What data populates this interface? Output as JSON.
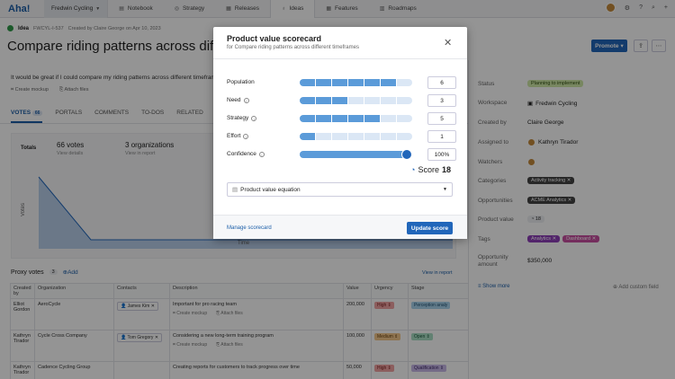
{
  "nav": {
    "logo": "Aha!",
    "workspace": "Fredwin Cycling",
    "tabs": [
      "Notebook",
      "Strategy",
      "Releases",
      "Ideas",
      "Features",
      "Roadmaps"
    ]
  },
  "idea": {
    "type": "Idea",
    "ref": "FWCYL-I-537",
    "created": "Created by Claire George on Apr 10, 2023",
    "title": "Compare riding patterns across different timeframes",
    "promote": "Promote",
    "description": "It would be great if I could compare my riding patterns across different timeframes",
    "create_mockup": "Create mockup",
    "attach_files": "Attach files"
  },
  "tabs": {
    "votes": "VOTES",
    "votes_count": "66",
    "portals": "PORTALS",
    "comments": "COMMENTS",
    "todos": "TO-DOS",
    "related": "RELATED"
  },
  "totals": {
    "label": "Totals",
    "votes": "66",
    "votes_unit": "votes",
    "votes_sub": "View details",
    "orgs": "3",
    "orgs_unit": "organizations",
    "orgs_sub": "View in report",
    "y_label": "Votes",
    "x_label": "Time"
  },
  "proxy": {
    "title": "Proxy votes",
    "count": "3",
    "add": "Add",
    "view_report": "View in report",
    "columns": [
      "Created by",
      "Organization",
      "Contacts",
      "Description",
      "Value",
      "Urgency",
      "Stage"
    ],
    "rows": [
      {
        "created_by": "Elliot Gordon",
        "org": "AeroCycle",
        "contact": "James Kim",
        "desc": "Important for pro racing team",
        "value": "200,000",
        "urgency": "High",
        "stage": "Perception analy"
      },
      {
        "created_by": "Kathryn Tirador",
        "org": "Cycle Cross Company",
        "contact": "Tom Gregory",
        "desc": "Considering a new long-term training program",
        "value": "100,000",
        "urgency": "Medium",
        "stage": "Open"
      },
      {
        "created_by": "Kathryn Tirador",
        "org": "Cadence Cycling Group",
        "contact": "",
        "desc": "Creating reports for customers to track progress over time",
        "value": "50,000",
        "urgency": "High",
        "stage": "Qualification"
      }
    ]
  },
  "panel": {
    "status_label": "Status",
    "status": "Planning to implement",
    "workspace_label": "Workspace",
    "workspace": "Fredwin Cycling",
    "created_label": "Created by",
    "created": "Claire George",
    "assigned_label": "Assigned to",
    "assigned": "Kathryn Tirador",
    "watchers_label": "Watchers",
    "categories_label": "Categories",
    "category": "Activity tracking",
    "opps_label": "Opportunities",
    "opp": "ACME Analytics",
    "pv_label": "Product value",
    "pv": "18",
    "tags_label": "Tags",
    "tags": [
      "Analytics",
      "Dashboard"
    ],
    "amount_label": "Opportunity amount",
    "amount": "$350,000",
    "show_more": "Show more",
    "add_field": "Add custom field"
  },
  "modal": {
    "title": "Product value scorecard",
    "subtitle": "for Compare riding patterns across different timeframes",
    "metrics": [
      {
        "label": "Population",
        "value": "6",
        "level": 6
      },
      {
        "label": "Need",
        "value": "3",
        "level": 3
      },
      {
        "label": "Strategy",
        "value": "5",
        "level": 5
      },
      {
        "label": "Effort",
        "value": "1",
        "level": 1
      }
    ],
    "confidence_label": "Confidence",
    "confidence_value": "100%",
    "confidence_pct": 100,
    "score_label": "Score",
    "score": "18",
    "equation": "Product value equation",
    "manage": "Manage scorecard",
    "update": "Update score"
  },
  "colors": {
    "primary": "#2166ba",
    "bar_on": "#5b9bd9",
    "bar_off": "#dbe7f5"
  }
}
